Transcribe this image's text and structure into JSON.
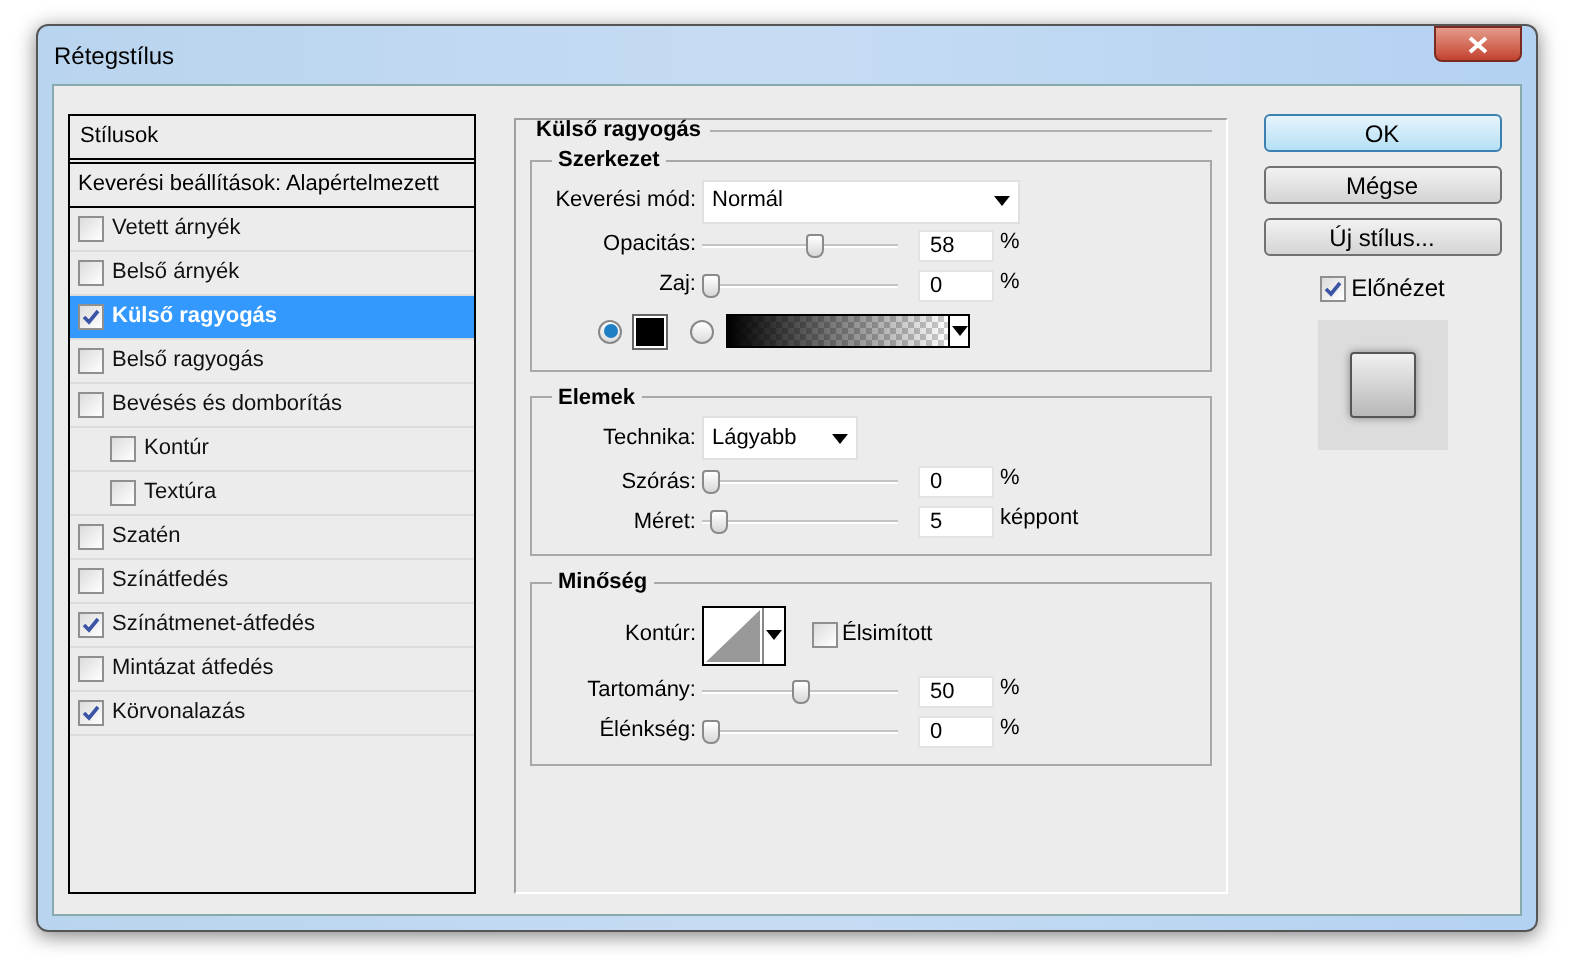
{
  "window": {
    "title": "Rétegstílus"
  },
  "styles_list": {
    "header": "Stílusok",
    "blending": "Keverési beállítások: Alapértelmezett",
    "items": [
      {
        "label": "Vetett árnyék",
        "checked": false,
        "selected": false
      },
      {
        "label": "Belső árnyék",
        "checked": false,
        "selected": false
      },
      {
        "label": "Külső ragyogás",
        "checked": true,
        "selected": true
      },
      {
        "label": "Belső ragyogás",
        "checked": false,
        "selected": false
      },
      {
        "label": "Bevésés és domborítás",
        "checked": false,
        "selected": false,
        "children": [
          {
            "label": "Kontúr",
            "checked": false,
            "selected": false
          },
          {
            "label": "Textúra",
            "checked": false,
            "selected": false
          }
        ]
      },
      {
        "label": "Szatén",
        "checked": false,
        "selected": false
      },
      {
        "label": "Színátfedés",
        "checked": false,
        "selected": false
      },
      {
        "label": "Színátmenet-átfedés",
        "checked": true,
        "selected": false
      },
      {
        "label": "Mintázat átfedés",
        "checked": false,
        "selected": false
      },
      {
        "label": "Körvonalazás",
        "checked": true,
        "selected": false
      }
    ]
  },
  "panel": {
    "title": "Külső ragyogás",
    "sections": [
      {
        "title": "Szerkezet",
        "rows": [
          {
            "kind": "select",
            "label": "Keverési mód:",
            "value": "Normál",
            "wide": true
          },
          {
            "kind": "slider",
            "label": "Opacitás:",
            "level": 0.58,
            "value": "58",
            "unit": "%"
          },
          {
            "kind": "slider",
            "label": "Zaj:",
            "level": 0,
            "value": "0",
            "unit": "%"
          },
          {
            "kind": "fill",
            "options": [
              {
                "kind": "swatch",
                "selected": true,
                "color": "#000000"
              },
              {
                "kind": "gradient",
                "selected": false
              }
            ]
          }
        ]
      },
      {
        "title": "Elemek",
        "rows": [
          {
            "kind": "select",
            "label": "Technika:",
            "value": "Lágyabb",
            "wide": false
          },
          {
            "kind": "slider",
            "label": "Szórás:",
            "level": 0,
            "value": "0",
            "unit": "%"
          },
          {
            "kind": "slider",
            "label": "Méret:",
            "level": 0.04,
            "value": "5",
            "unit": "képpont"
          }
        ]
      },
      {
        "title": "Minőség",
        "rows": [
          {
            "kind": "contour",
            "label": "Kontúr:",
            "checkbox": {
              "label": "Élsimított",
              "checked": false
            }
          },
          {
            "kind": "slider",
            "label": "Tartomány:",
            "level": 0.5,
            "value": "50",
            "unit": "%"
          },
          {
            "kind": "slider",
            "label": "Élénkség:",
            "level": 0,
            "value": "0",
            "unit": "%"
          }
        ]
      }
    ]
  },
  "buttons": [
    {
      "label": "OK",
      "default": true
    },
    {
      "label": "Mégse",
      "default": false
    },
    {
      "label": "Új stílus...",
      "default": false
    }
  ],
  "preview": {
    "label": "Előnézet",
    "checked": true
  }
}
